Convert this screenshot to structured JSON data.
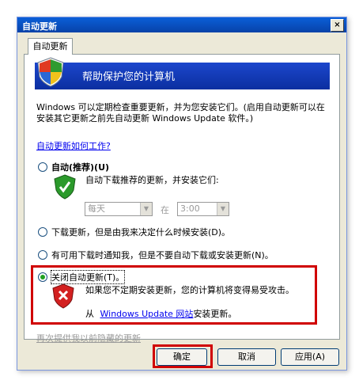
{
  "window": {
    "title": "自动更新",
    "close_glyph": "×"
  },
  "tab": {
    "label": "自动更新"
  },
  "banner": {
    "text": "帮助保护您的计算机"
  },
  "description": "Windows 可以定期检查重要更新，并为您安装它们。(启用自动更新可以在安装其它更新之前先自动更新 Windows Update 软件。)",
  "how_link": "自动更新如何工作?",
  "options": {
    "auto": {
      "label": "自动(推荐)(U)",
      "detail": "自动下载推荐的更新，并安装它们:"
    },
    "schedule": {
      "day": "每天",
      "at": "在",
      "time": "3:00"
    },
    "download": {
      "label": "下载更新，但是由我来决定什么时候安装(D)。"
    },
    "notify": {
      "label": "有可用下载时通知我，但是不要自动下载或安装更新(N)。"
    },
    "off": {
      "label": "关闭自动更新(T)。",
      "warning": "如果您不定期安装更新，您的计算机将变得易受攻击。",
      "install_from": "从",
      "site_link": "Windows Update 网站",
      "install_suffix": "安装更新。"
    }
  },
  "hidden_updates_link": "再次提供我以前隐藏的更新",
  "buttons": {
    "ok": "确定",
    "cancel": "取消",
    "apply": "应用(A)"
  },
  "selected_option": "off",
  "colors": {
    "highlight": "#d00000",
    "title_bar": "#0842a8"
  }
}
